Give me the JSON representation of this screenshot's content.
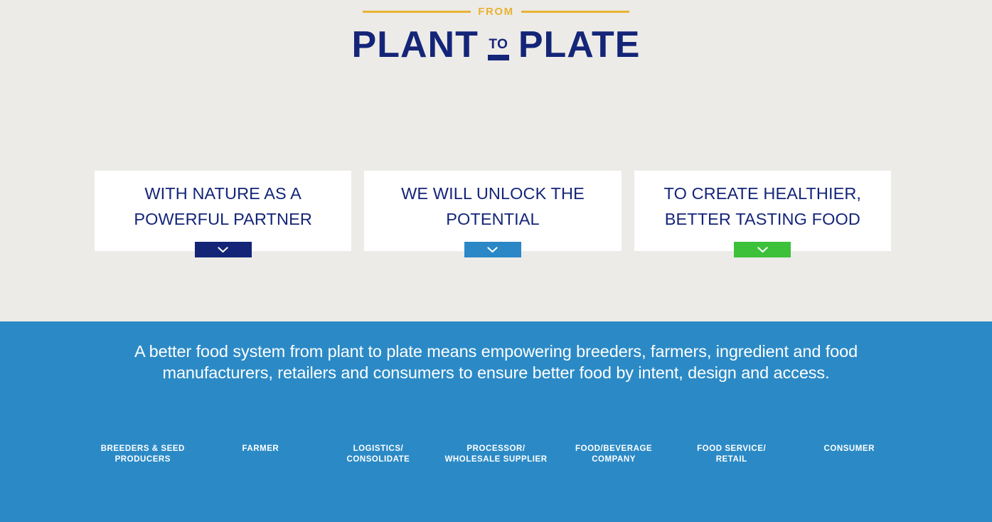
{
  "logo": {
    "eyebrow": "FROM",
    "word_one": "PLANT",
    "connector": "TO",
    "word_two": "PLATE"
  },
  "cards": [
    {
      "title": "WITH NATURE AS A POWERFUL PARTNER",
      "button_icon": "chevron-down-icon",
      "button_color": "#142578"
    },
    {
      "title": "WE WILL UNLOCK THE POTENTIAL",
      "button_icon": "chevron-down-icon",
      "button_color": "#2b87c6"
    },
    {
      "title": "TO CREATE HEALTHIER, BETTER TASTING FOOD",
      "button_icon": "chevron-down-icon",
      "button_color": "#3dc13a"
    }
  ],
  "banner": {
    "statement": "A better food system from plant to plate means empowering breeders, farmers, ingredient and food manufacturers, retailers and consumers to ensure better food by intent, design and access.",
    "chain": [
      "BREEDERS & SEED\nPRODUCERS",
      "FARMER",
      "LOGISTICS/\nCONSOLIDATE",
      "PROCESSOR/\nWHOLESALE SUPPLIER",
      "FOOD/BEVERAGE\nCOMPANY",
      "FOOD SERVICE/\nRETAIL",
      "CONSUMER"
    ]
  },
  "colors": {
    "page_background": "#edebe8",
    "navy": "#142578",
    "gold": "#e8b233",
    "banner_blue": "#2b8ac6",
    "light_blue": "#2b87c6",
    "green": "#3dc13a",
    "card_background": "#ffffff"
  }
}
